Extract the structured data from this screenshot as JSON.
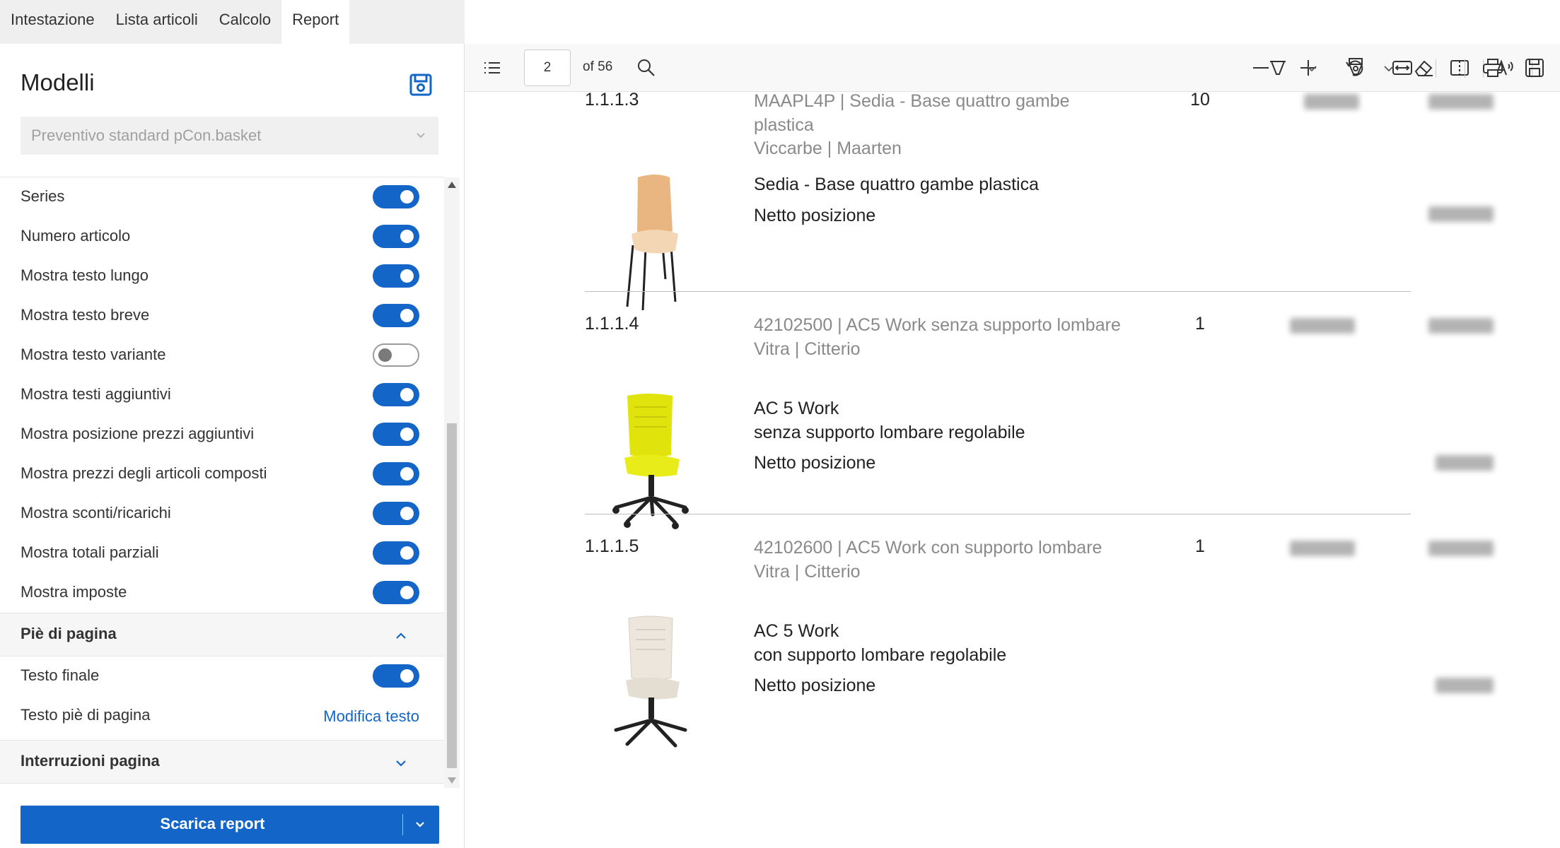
{
  "tabs": [
    {
      "label": "Intestazione",
      "active": false
    },
    {
      "label": "Lista articoli",
      "active": false
    },
    {
      "label": "Calcolo",
      "active": false
    },
    {
      "label": "Report",
      "active": true
    }
  ],
  "panel": {
    "title": "Modelli",
    "model_select": {
      "value": "Preventivo standard pCon.basket",
      "disabled": true
    },
    "options": [
      {
        "label": "Series",
        "on": true
      },
      {
        "label": "Numero articolo",
        "on": true
      },
      {
        "label": "Mostra testo lungo",
        "on": true
      },
      {
        "label": "Mostra testo breve",
        "on": true
      },
      {
        "label": "Mostra testo variante",
        "on": false
      },
      {
        "label": "Mostra testi aggiuntivi",
        "on": true
      },
      {
        "label": "Mostra posizione prezzi aggiuntivi",
        "on": true
      },
      {
        "label": "Mostra prezzi degli articoli composti",
        "on": true
      },
      {
        "label": "Mostra sconti/ricarichi",
        "on": true
      },
      {
        "label": "Mostra totali parziali",
        "on": true
      },
      {
        "label": "Mostra imposte",
        "on": true
      }
    ],
    "footer_section": {
      "label": "Piè di pagina",
      "expanded": true,
      "final_text": {
        "label": "Testo finale",
        "on": true
      },
      "footer_text": {
        "label": "Testo piè di pagina",
        "link": "Modifica testo"
      }
    },
    "page_breaks_section": {
      "label": "Interruzioni pagina",
      "expanded": false
    },
    "download_label": "Scarica report"
  },
  "viewer": {
    "page": "2",
    "of_pages": "of 56",
    "items": [
      {
        "number": "1.1.1.3",
        "code_line": "MAAPL4P | Sedia - Base quattro gambe plastica",
        "maker_line": "Viccarbe | Maarten",
        "qty": "10",
        "title_lines": [
          "Sedia - Base quattro gambe plastica"
        ],
        "net_label": "Netto posizione",
        "image": "chair-icon"
      },
      {
        "number": "1.1.1.4",
        "code_line": "42102500 | AC5 Work senza supporto lombare",
        "maker_line": "Vitra | Citterio",
        "qty": "1",
        "title_lines": [
          "AC 5 Work",
          "senza supporto lombare regolabile"
        ],
        "net_label": "Netto posizione",
        "image": "office-chair-yellow-icon"
      },
      {
        "number": "1.1.1.5",
        "code_line": "42102600 | AC5 Work con supporto lombare",
        "maker_line": "Vitra | Citterio",
        "qty": "1",
        "title_lines": [
          "AC 5 Work",
          "con supporto lombare regolabile"
        ],
        "net_label": "Netto posizione",
        "image": "office-chair-white-icon"
      }
    ]
  },
  "colors": {
    "accent": "#1366c8",
    "tab_bar": "#efefef",
    "chair_wood": "#e9b682",
    "chair_yellow": "#e0e40c",
    "chair_white": "#ece6dc"
  }
}
